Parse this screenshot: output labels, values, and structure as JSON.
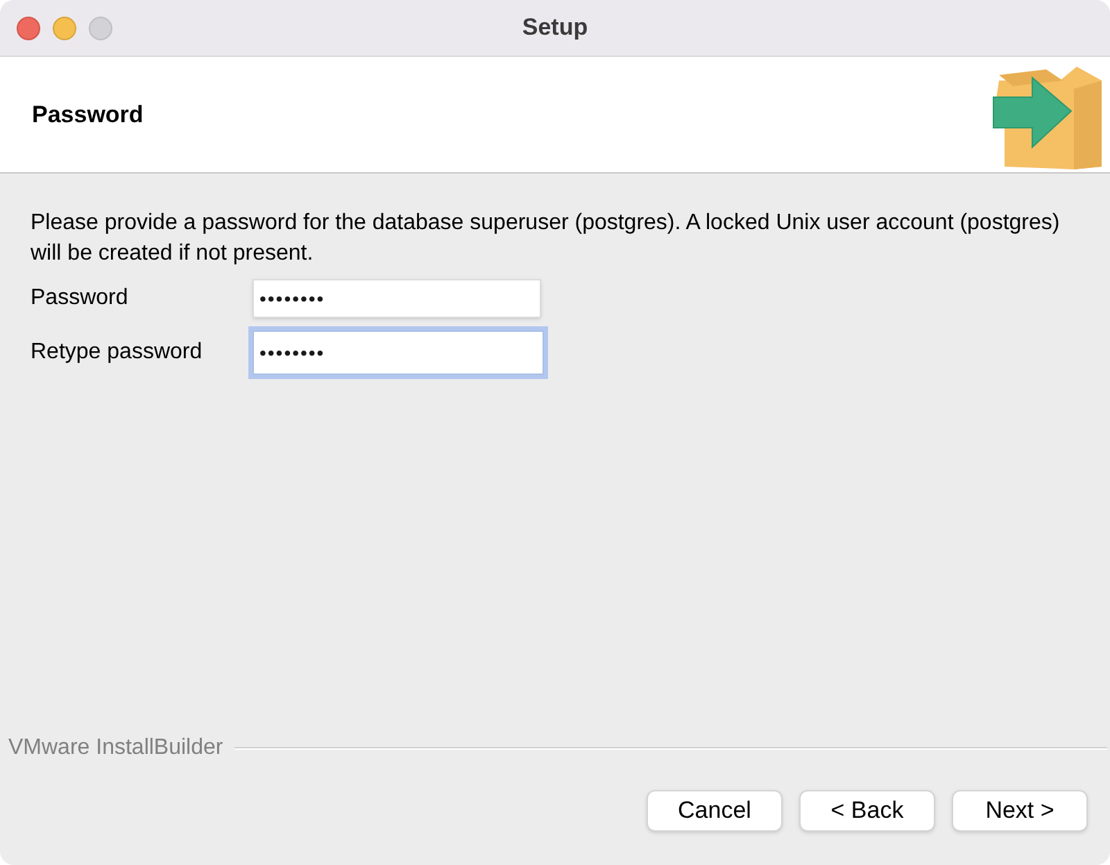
{
  "window": {
    "title": "Setup"
  },
  "header": {
    "title": "Password"
  },
  "description": "Please provide a password for the database superuser (postgres). A locked Unix user account (postgres) will be created if not present.",
  "fields": [
    {
      "label": "Password",
      "value": "••••••••",
      "focused": false
    },
    {
      "label": "Retype password",
      "value": "••••••••",
      "focused": true
    }
  ],
  "footer": {
    "brand": "VMware InstallBuilder"
  },
  "buttons": [
    "Cancel",
    "< Back",
    "Next >"
  ]
}
